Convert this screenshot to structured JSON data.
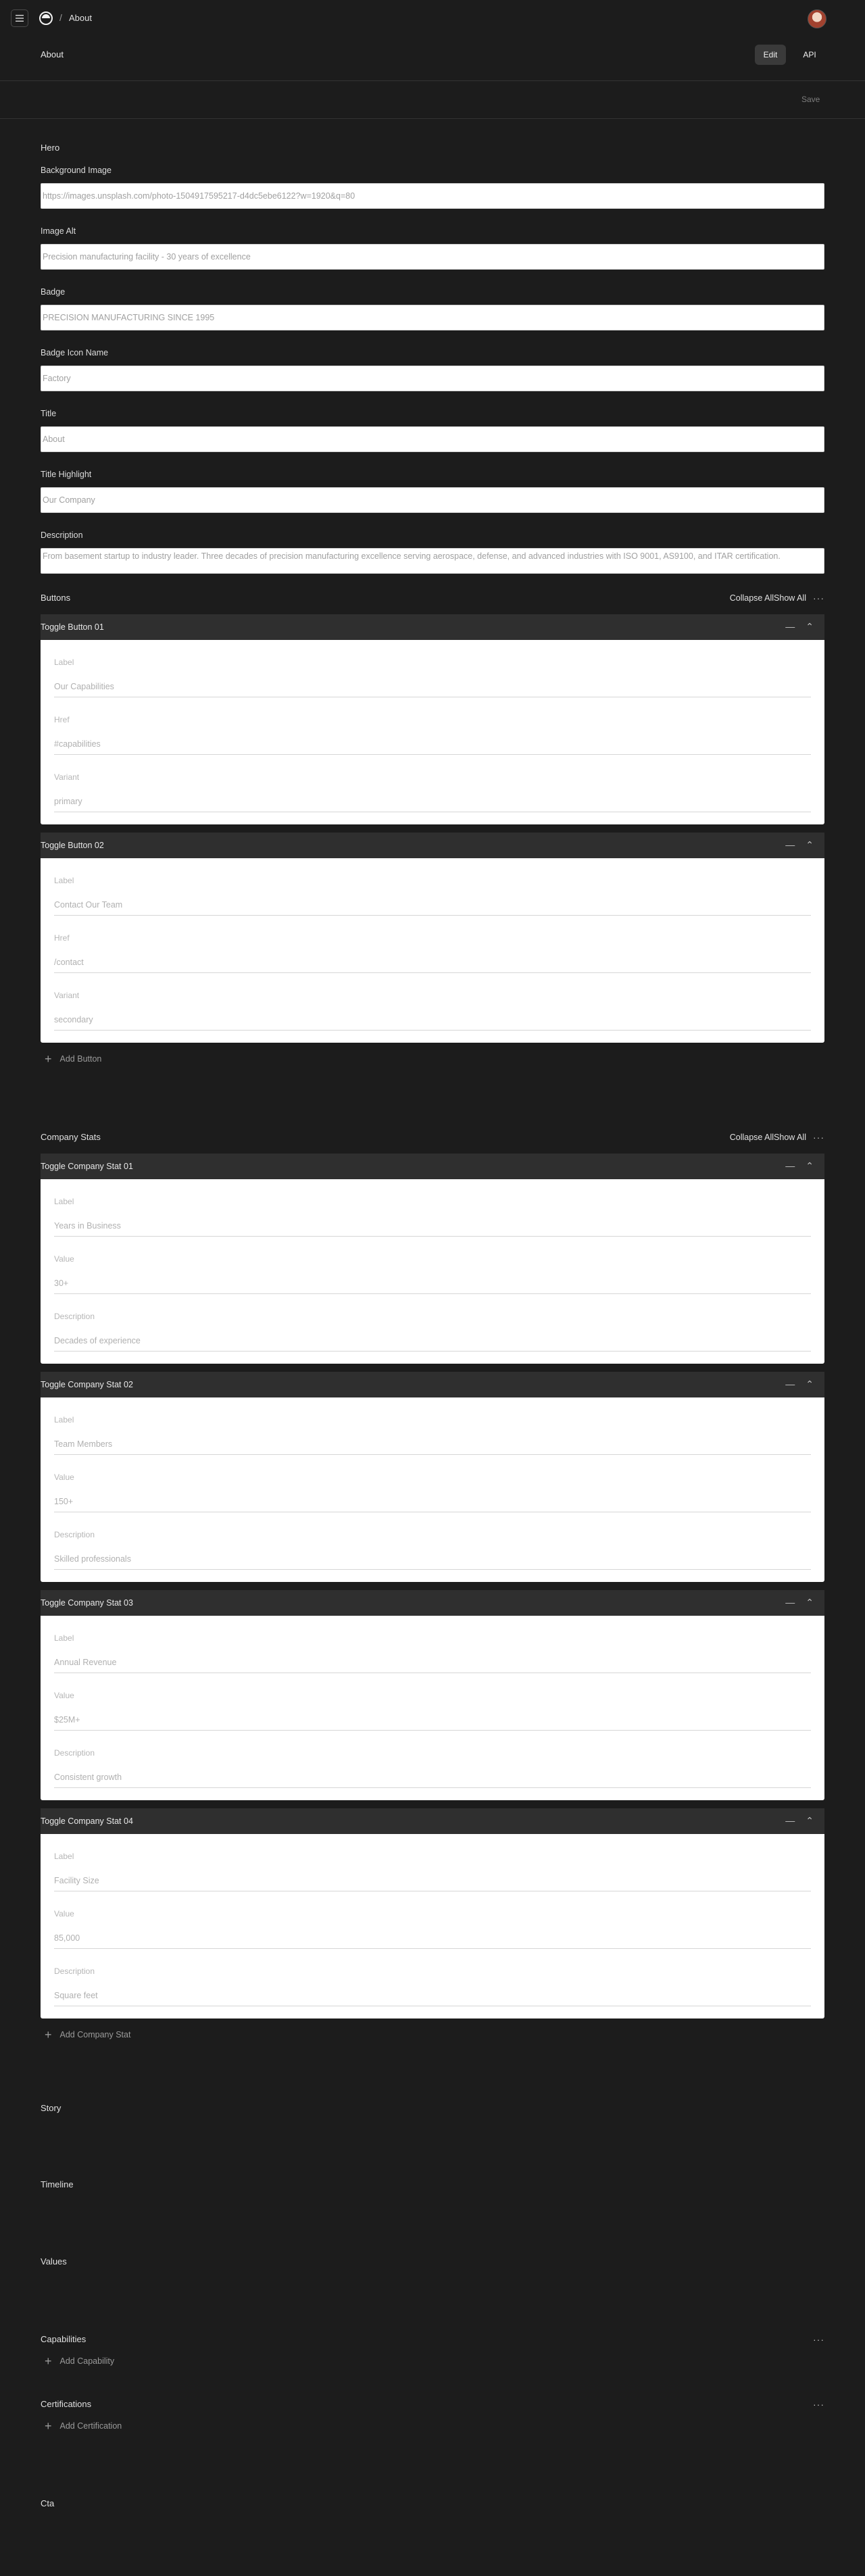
{
  "breadcrumb": {
    "separator": "/",
    "current": "About"
  },
  "page": {
    "title": "About"
  },
  "modes": {
    "edit": "Edit",
    "api": "API"
  },
  "save_label": "Save",
  "hero": {
    "section_title": "Hero",
    "fields": [
      {
        "label": "Background Image",
        "value": "https://images.unsplash.com/photo-1504917595217-d4dc5ebe6122?w=1920&q=80"
      },
      {
        "label": "Image Alt",
        "value": "Precision manufacturing facility - 30 years of excellence"
      },
      {
        "label": "Badge",
        "value": "PRECISION MANUFACTURING SINCE 1995"
      },
      {
        "label": "Badge Icon Name",
        "value": "Factory"
      },
      {
        "label": "Title",
        "value": "About"
      },
      {
        "label": "Title Highlight",
        "value": "Our Company"
      }
    ],
    "description": {
      "label": "Description",
      "value": "From basement startup to industry leader. Three decades of precision manufacturing excellence serving aerospace, defense, and advanced industries with ISO 9001, AS9100, and ITAR certification."
    },
    "buttons": {
      "title": "Buttons",
      "collapse_all": "Collapse All",
      "show_all": "Show All",
      "more": "···",
      "items": [
        {
          "toggle_text": "Toggle Button 01",
          "fields": [
            {
              "label": "Label",
              "value": "Our Capabilities"
            },
            {
              "label": "Href",
              "value": "#capabilities"
            },
            {
              "label": "Variant",
              "value": "primary"
            }
          ]
        },
        {
          "toggle_text": "Toggle Button 02",
          "fields": [
            {
              "label": "Label",
              "value": "Contact Our Team"
            },
            {
              "label": "Href",
              "value": "/contact"
            },
            {
              "label": "Variant",
              "value": "secondary"
            }
          ]
        }
      ],
      "add_label": "Add Button"
    },
    "stats": {
      "title": "Company Stats",
      "collapse_all": "Collapse All",
      "show_all": "Show All",
      "more": "···",
      "items": [
        {
          "toggle_text": "Toggle Company Stat 01",
          "fields": [
            {
              "label": "Label",
              "value": "Years in Business"
            },
            {
              "label": "Value",
              "value": "30+"
            },
            {
              "label": "Description",
              "value": "Decades of experience"
            }
          ]
        },
        {
          "toggle_text": "Toggle Company Stat 02",
          "fields": [
            {
              "label": "Label",
              "value": "Team Members"
            },
            {
              "label": "Value",
              "value": "150+"
            },
            {
              "label": "Description",
              "value": "Skilled professionals"
            }
          ]
        },
        {
          "toggle_text": "Toggle Company Stat 03",
          "fields": [
            {
              "label": "Label",
              "value": "Annual Revenue"
            },
            {
              "label": "Value",
              "value": "$25M+"
            },
            {
              "label": "Description",
              "value": "Consistent growth"
            }
          ]
        },
        {
          "toggle_text": "Toggle Company Stat 04",
          "fields": [
            {
              "label": "Label",
              "value": "Facility Size"
            },
            {
              "label": "Value",
              "value": "85,000"
            },
            {
              "label": "Description",
              "value": "Square feet"
            }
          ]
        }
      ],
      "add_label": "Add Company Stat"
    }
  },
  "sections": {
    "story": "Story",
    "timeline": "Timeline",
    "values": "Values",
    "capabilities": {
      "title": "Capabilities",
      "more": "···",
      "add_label": "Add Capability"
    },
    "certifications": {
      "title": "Certifications",
      "more": "···",
      "add_label": "Add Certification"
    },
    "cta": "Cta"
  },
  "icons": [
    "menu-icon",
    "logo-icon",
    "minus-icon",
    "chevron-up-icon",
    "plus-icon",
    "more-icon"
  ]
}
